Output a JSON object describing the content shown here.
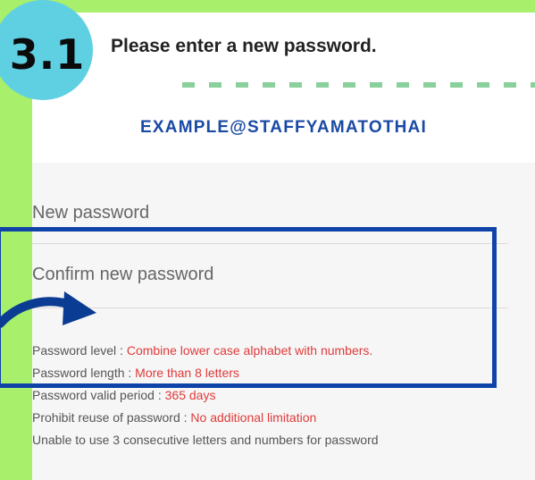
{
  "step": {
    "number": "3.1"
  },
  "header": {
    "instruction": "Please enter a new password."
  },
  "form": {
    "email": "EXAMPLE@STAFFYAMATOTHAI",
    "new_password_placeholder": "New password",
    "confirm_password_placeholder": "Confirm new password"
  },
  "rules": [
    {
      "label": "Password level : ",
      "value": "Combine lower case alphabet with numbers."
    },
    {
      "label": "Password length : ",
      "value": "More than 8 letters"
    },
    {
      "label": "Password valid period : ",
      "value": "365 days"
    },
    {
      "label": "Prohibit reuse of password : ",
      "value": "No additional limitation"
    },
    {
      "label": "Unable to use 3 consecutive letters and numbers for password",
      "value": ""
    }
  ],
  "colors": {
    "background": "#a8ef6c",
    "badge": "#5fd0e2",
    "email_title": "#1a4aa5",
    "highlight_box": "#1043a8",
    "rule_value": "#e03a3a"
  },
  "icons": {
    "arrow": "curved-arrow-icon"
  }
}
